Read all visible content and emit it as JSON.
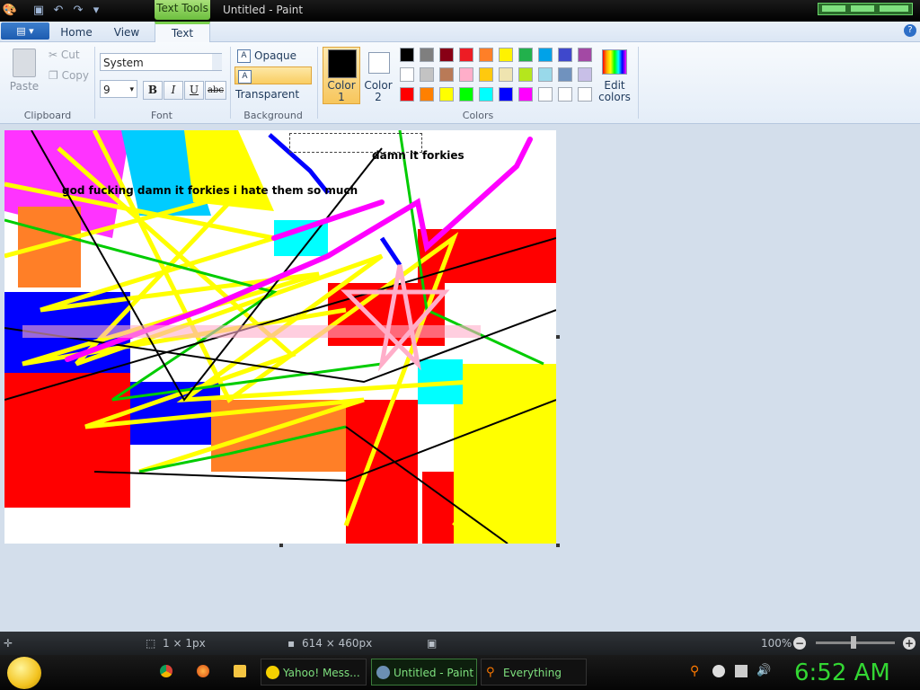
{
  "window": {
    "title": "Untitled - Paint",
    "context_tab": "Text Tools"
  },
  "ribbon_tabs": [
    "Home",
    "View",
    "Text"
  ],
  "clipboard": {
    "paste": "Paste",
    "cut": "Cut",
    "copy": "Copy",
    "group": "Clipboard"
  },
  "font": {
    "family": "System",
    "size": "9",
    "bold": "B",
    "italic": "I",
    "underline": "U",
    "strike": "abc",
    "group": "Font"
  },
  "background": {
    "opaque": "Opaque",
    "transparent": "Transparent",
    "group": "Background",
    "selected": "Transparent"
  },
  "colors": {
    "color1_label": "Color 1",
    "color2_label": "Color 2",
    "edit_label": "Edit colors",
    "group": "Colors",
    "color1": "#000000",
    "color2": "#ffffff",
    "palette": [
      "#000000",
      "#7f7f7f",
      "#880015",
      "#ed1c24",
      "#ff7f27",
      "#fff200",
      "#22b14c",
      "#00a2e8",
      "#3f48cc",
      "#a349a4",
      "#ffffff",
      "#c3c3c3",
      "#b97a57",
      "#ffaec9",
      "#ffc90e",
      "#efe4b0",
      "#b5e61d",
      "#99d9ea",
      "#7092be",
      "#c8bfe7",
      "#ff0000",
      "#ff8000",
      "#ffff00",
      "#00ff00",
      "#00ffff",
      "#0000ff",
      "#ff00ff",
      "#ffffff",
      "#ffffff",
      "#ffffff"
    ]
  },
  "canvas": {
    "text_top": "damn it forkies",
    "text_main": "god fucking damn it forkies i hate them so much"
  },
  "status": {
    "selection": "1 × 1px",
    "image_size": "614 × 460px",
    "zoom": "100%"
  },
  "taskbar": {
    "tasks": [
      "Yahoo! Mess...",
      "Untitled - Paint",
      "Everything"
    ],
    "clock": "6:52 AM"
  }
}
